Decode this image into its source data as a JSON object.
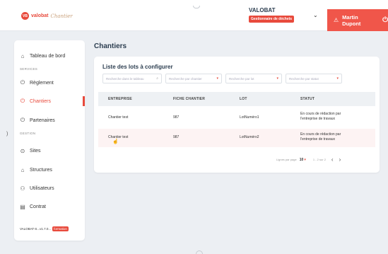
{
  "header": {
    "brand_initials": "VB",
    "brand_name": "valobat",
    "brand_script": "Chantier",
    "company_name": "VALOBAT",
    "company_role": "Gestionnaire de déchets",
    "chevron": "⌄",
    "user_name": "Martin Dupont",
    "warn_icon": "⚠",
    "power_icon": "⏻"
  },
  "sidebar": {
    "dashboard": "Tableau de bord",
    "section_services": "SERVICES",
    "reglement": "Règlement",
    "chantiers": "Chantiers",
    "partenaires": "Partenaires",
    "section_gestion": "GESTION",
    "sites": "Sites",
    "structures": "Structures",
    "utilisateurs": "Utilisateurs",
    "contrat": "Contrat",
    "version": "VALOBAT-S...v1.7.0...",
    "env_badge": "formation"
  },
  "main": {
    "page_title": "Chantiers",
    "card_title": "Liste des lots à configurer",
    "filters": {
      "search": "Recherche dans le tableau",
      "chantier": "Recherche par chantier",
      "lot": "Recherche par lot",
      "statut": "Recherche par statut"
    },
    "columns": [
      "ENTREPRISE",
      "FICHE CHANTIER",
      "LOT",
      "STATUT"
    ],
    "rows": [
      {
        "entreprise": "Chantier test",
        "fiche": "987",
        "lot": "LotNuméro1",
        "statut_1": "En cours de rédaction par",
        "statut_2": "l'entreprise de travaux"
      },
      {
        "entreprise": "Chantier test",
        "fiche": "987",
        "lot": "LotNuméro2",
        "statut_1": "En cours de rédaction par",
        "statut_2": "l'entreprise de travaux"
      }
    ],
    "pager": {
      "rows_per_page_label": "Lignes par page",
      "rows_per_page_value": "10",
      "range": "1 - 2 sur 2",
      "prev": "‹",
      "next": "›"
    }
  },
  "colors": {
    "accent": "#e84a3c",
    "user_button": "#f0564a",
    "header_row": "#eef1f4",
    "background": "#eceff3"
  }
}
